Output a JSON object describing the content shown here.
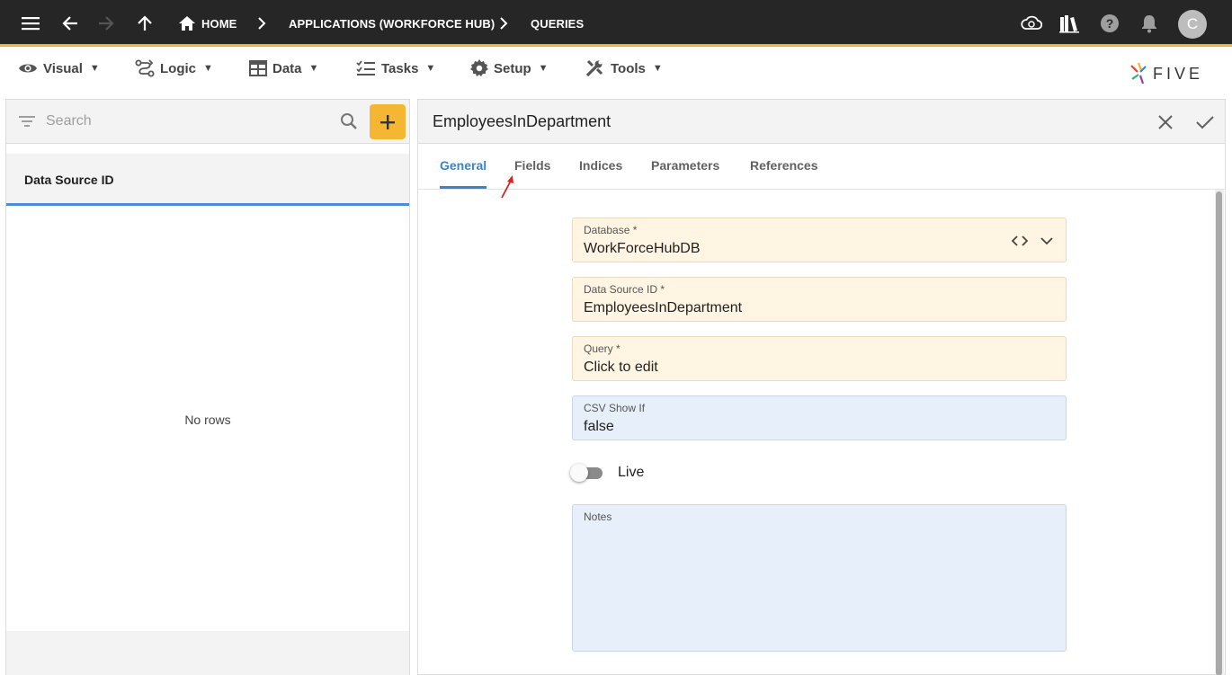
{
  "topbar": {
    "breadcrumbs": [
      "HOME",
      "APPLICATIONS (WORKFORCE HUB)",
      "QUERIES"
    ],
    "avatar_initial": "C"
  },
  "menu": {
    "items": [
      {
        "label": "Visual",
        "icon": "eye-icon"
      },
      {
        "label": "Logic",
        "icon": "logic-icon"
      },
      {
        "label": "Data",
        "icon": "table-icon"
      },
      {
        "label": "Tasks",
        "icon": "checklist-icon"
      },
      {
        "label": "Setup",
        "icon": "gear-icon"
      },
      {
        "label": "Tools",
        "icon": "tools-icon"
      }
    ],
    "caret": "▼"
  },
  "logo": {
    "text": "FIVE"
  },
  "left_panel": {
    "search_placeholder": "Search",
    "column_header": "Data Source ID",
    "empty_text": "No rows"
  },
  "form": {
    "title": "EmployeesInDepartment",
    "tabs": [
      "General",
      "Fields",
      "Indices",
      "Parameters",
      "References"
    ],
    "active_tab": "General",
    "fields": {
      "database": {
        "label": "Database *",
        "value": "WorkForceHubDB"
      },
      "data_source_id": {
        "label": "Data Source ID *",
        "value": "EmployeesInDepartment"
      },
      "query": {
        "label": "Query *",
        "value": "Click to edit"
      },
      "csv_show_if": {
        "label": "CSV Show If",
        "value": "false"
      },
      "live": {
        "label": "Live",
        "checked": false
      },
      "notes": {
        "label": "Notes",
        "value": ""
      }
    }
  },
  "colors": {
    "topbar": "#262626",
    "accent": "#f2b233",
    "add_button": "#f5b731",
    "active_tab": "#3d82c8",
    "required_field_bg": "#fff5e2",
    "optional_field_bg": "#e7f0fa",
    "annotation_arrow": "#e02020"
  }
}
